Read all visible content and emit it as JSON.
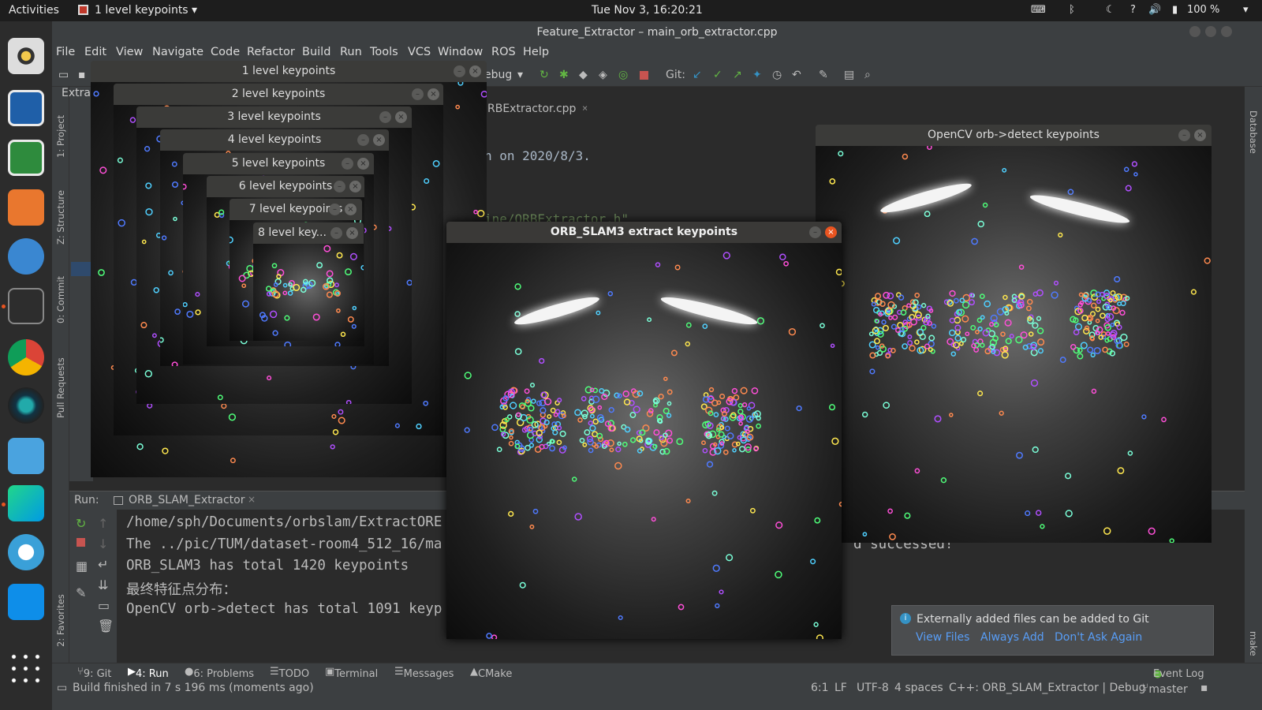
{
  "topbar": {
    "activities": "Activities",
    "app_menu": "1 level keypoints",
    "clock": "Tue Nov  3, 16:20:21",
    "help": "?",
    "battery": "100 %"
  },
  "ide": {
    "title": "Feature_Extractor – main_orb_extractor.cpp",
    "menu": [
      "File",
      "Edit",
      "View",
      "Navigate",
      "Code",
      "Refactor",
      "Build",
      "Run",
      "Tools",
      "VCS",
      "Window",
      "ROS",
      "Help"
    ],
    "toolbar_config": "ebug",
    "git_label": "Git:",
    "project_tab": "Extra",
    "editor_tab": "RBExtractor.cpp",
    "code_lines": [
      "h on 2020/8/3.",
      "ine/ORBExtractor.h\""
    ],
    "left_tabs": [
      "1: Project",
      "Z: Structure",
      "0: Commit",
      "Pull Requests",
      "2: Favorites"
    ],
    "right_tabs": [
      "Database",
      "make"
    ]
  },
  "run": {
    "label": "Run:",
    "config_tab": "ORB_SLAM_Extractor",
    "console_lines": [
      "/home/sph/Documents/orbslam/ExtractORE",
      "The ../pic/TUM/dataset-room4_512_16/ma",
      "ORB_SLAM3 has total 1420 keypoints",
      "最终特征点分布：",
      "OpenCV orb->detect has total 1091 keyp"
    ],
    "console_tail": "d successed!"
  },
  "bottom_tabs": [
    "9: Git",
    "4: Run",
    "6: Problems",
    "TODO",
    "Terminal",
    "Messages",
    "CMake",
    "Event Log"
  ],
  "status": {
    "message": "Build finished in 7 s 196 ms (moments ago)",
    "position": "6:1",
    "line_sep": "LF",
    "encoding": "UTF-8",
    "indent": "4 spaces",
    "context": "C++: ORB_SLAM_Extractor | Debug",
    "branch": "master"
  },
  "notification": {
    "text": "Externally added files can be added to Git",
    "actions": [
      "View Files",
      "Always Add",
      "Don't Ask Again"
    ]
  },
  "windows": {
    "level1": "1 level keypoints",
    "level2": "2 level keypoints",
    "level3": "3 level keypoints",
    "level4": "4 level keypoints",
    "level5": "5 level keypoints",
    "level6": "6 level keypoints",
    "level7": "7 level keypoints",
    "level8": "8 level key...",
    "orbslam3": "ORB_SLAM3 extract keypoints",
    "opencv": "OpenCV orb->detect keypoints"
  },
  "colors": {
    "accent": "#e95420",
    "link": "#589df6",
    "git_green": "#62b543",
    "git_blue": "#3592c4"
  }
}
